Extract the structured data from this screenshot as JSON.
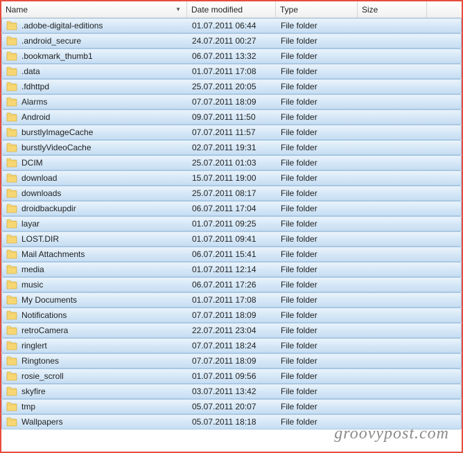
{
  "columns": {
    "name": "Name",
    "date": "Date modified",
    "type": "Type",
    "size": "Size"
  },
  "sort_indicator": "▼",
  "watermark": "groovypost.com",
  "files": [
    {
      "name": ".adobe-digital-editions",
      "date": "01.07.2011 06:44",
      "type": "File folder",
      "size": ""
    },
    {
      "name": ".android_secure",
      "date": "24.07.2011 00:27",
      "type": "File folder",
      "size": ""
    },
    {
      "name": ".bookmark_thumb1",
      "date": "06.07.2011 13:32",
      "type": "File folder",
      "size": ""
    },
    {
      "name": ".data",
      "date": "01.07.2011 17:08",
      "type": "File folder",
      "size": ""
    },
    {
      "name": ".fdhttpd",
      "date": "25.07.2011 20:05",
      "type": "File folder",
      "size": ""
    },
    {
      "name": "Alarms",
      "date": "07.07.2011 18:09",
      "type": "File folder",
      "size": ""
    },
    {
      "name": "Android",
      "date": "09.07.2011 11:50",
      "type": "File folder",
      "size": ""
    },
    {
      "name": "burstlyImageCache",
      "date": "07.07.2011 11:57",
      "type": "File folder",
      "size": ""
    },
    {
      "name": "burstlyVideoCache",
      "date": "02.07.2011 19:31",
      "type": "File folder",
      "size": ""
    },
    {
      "name": "DCIM",
      "date": "25.07.2011 01:03",
      "type": "File folder",
      "size": ""
    },
    {
      "name": "download",
      "date": "15.07.2011 19:00",
      "type": "File folder",
      "size": ""
    },
    {
      "name": "downloads",
      "date": "25.07.2011 08:17",
      "type": "File folder",
      "size": ""
    },
    {
      "name": "droidbackupdir",
      "date": "06.07.2011 17:04",
      "type": "File folder",
      "size": ""
    },
    {
      "name": "layar",
      "date": "01.07.2011 09:25",
      "type": "File folder",
      "size": ""
    },
    {
      "name": "LOST.DIR",
      "date": "01.07.2011 09:41",
      "type": "File folder",
      "size": ""
    },
    {
      "name": "Mail Attachments",
      "date": "06.07.2011 15:41",
      "type": "File folder",
      "size": ""
    },
    {
      "name": "media",
      "date": "01.07.2011 12:14",
      "type": "File folder",
      "size": ""
    },
    {
      "name": "music",
      "date": "06.07.2011 17:26",
      "type": "File folder",
      "size": ""
    },
    {
      "name": "My Documents",
      "date": "01.07.2011 17:08",
      "type": "File folder",
      "size": ""
    },
    {
      "name": "Notifications",
      "date": "07.07.2011 18:09",
      "type": "File folder",
      "size": ""
    },
    {
      "name": "retroCamera",
      "date": "22.07.2011 23:04",
      "type": "File folder",
      "size": ""
    },
    {
      "name": "ringlert",
      "date": "07.07.2011 18:24",
      "type": "File folder",
      "size": ""
    },
    {
      "name": "Ringtones",
      "date": "07.07.2011 18:09",
      "type": "File folder",
      "size": ""
    },
    {
      "name": "rosie_scroll",
      "date": "01.07.2011 09:56",
      "type": "File folder",
      "size": ""
    },
    {
      "name": "skyfire",
      "date": "03.07.2011 13:42",
      "type": "File folder",
      "size": ""
    },
    {
      "name": "tmp",
      "date": "05.07.2011 20:07",
      "type": "File folder",
      "size": ""
    },
    {
      "name": "Wallpapers",
      "date": "05.07.2011 18:18",
      "type": "File folder",
      "size": ""
    }
  ]
}
